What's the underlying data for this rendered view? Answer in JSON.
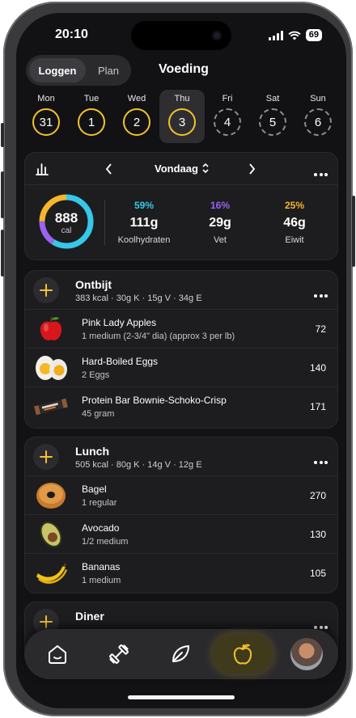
{
  "status": {
    "time": "20:10",
    "battery": "69"
  },
  "header": {
    "segments": [
      "Loggen",
      "Plan"
    ],
    "title": "Voeding"
  },
  "week": [
    {
      "label": "Mon",
      "day": "31"
    },
    {
      "label": "Tue",
      "day": "1"
    },
    {
      "label": "Wed",
      "day": "2"
    },
    {
      "label": "Thu",
      "day": "3"
    },
    {
      "label": "Fri",
      "day": "4"
    },
    {
      "label": "Sat",
      "day": "5"
    },
    {
      "label": "Sun",
      "day": "6"
    }
  ],
  "summary": {
    "date_label": "Vondaag",
    "calories": "888",
    "calories_unit": "cal",
    "macros": [
      {
        "pct": "59%",
        "grams": "111g",
        "label": "Koolhydraten",
        "color": "#35c8e8"
      },
      {
        "pct": "16%",
        "grams": "29g",
        "label": "Vet",
        "color": "#9a63f2"
      },
      {
        "pct": "25%",
        "grams": "46g",
        "label": "Eiwit",
        "color": "#f5b52d"
      }
    ]
  },
  "meals": [
    {
      "title": "Ontbijt",
      "summary": "383 kcal  ·  30g K · 15g V · 34g E",
      "foods": [
        {
          "name": "Pink Lady Apples",
          "desc": "1 medium (2-3/4\" dia) (approx 3 per lb)",
          "cal": "72",
          "icon": "apple"
        },
        {
          "name": "Hard-Boiled Eggs",
          "desc": "2 Eggs",
          "cal": "140",
          "icon": "egg"
        },
        {
          "name": "Protein Bar Bownie-Schoko-Crisp",
          "desc": "45 gram",
          "cal": "171",
          "icon": "protein-bar"
        }
      ]
    },
    {
      "title": "Lunch",
      "summary": "505 kcal  ·  80g K · 14g V · 12g E",
      "foods": [
        {
          "name": "Bagel",
          "desc": "1 regular",
          "cal": "270",
          "icon": "bagel"
        },
        {
          "name": "Avocado",
          "desc": "1/2 medium",
          "cal": "130",
          "icon": "avocado"
        },
        {
          "name": "Bananas",
          "desc": "1 medium",
          "cal": "105",
          "icon": "banana"
        }
      ]
    },
    {
      "title": "Diner"
    }
  ],
  "accent": "#f5c22d",
  "nav": [
    "home-icon",
    "dumbbell-icon",
    "leaf-icon",
    "apple-icon",
    "avatar"
  ]
}
